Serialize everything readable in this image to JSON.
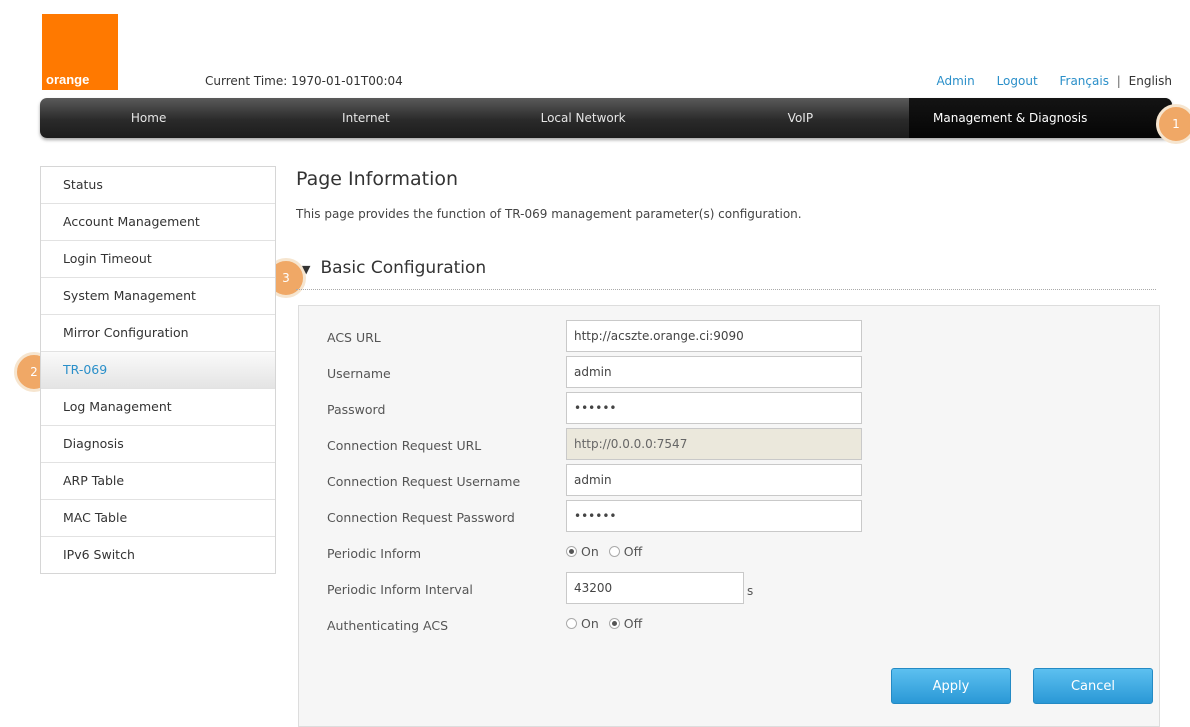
{
  "brand": {
    "logo_text": "orange",
    "color": "#ff7900"
  },
  "header": {
    "current_time_label": "Current Time:",
    "current_time_value": "1970-01-01T00:04",
    "links": {
      "admin": "Admin",
      "logout": "Logout",
      "francais": "Français",
      "separator": "|",
      "english": "English"
    }
  },
  "nav": {
    "items": [
      "Home",
      "Internet",
      "Local Network",
      "VoIP",
      "Management & Diagnosis"
    ],
    "active": "Management & Diagnosis"
  },
  "badges": [
    "1",
    "2",
    "3"
  ],
  "sidebar": {
    "items": [
      "Status",
      "Account Management",
      "Login Timeout",
      "System Management",
      "Mirror Configuration",
      "TR-069",
      "Log Management",
      "Diagnosis",
      "ARP Table",
      "MAC Table",
      "IPv6 Switch"
    ],
    "active": "TR-069"
  },
  "page": {
    "title": "Page Information",
    "description": "This page provides the function of TR-069 management parameter(s) configuration.",
    "section": "Basic Configuration"
  },
  "form": {
    "acs_url": {
      "label": "ACS URL",
      "value": "http://acszte.orange.ci:9090"
    },
    "username": {
      "label": "Username",
      "value": "admin"
    },
    "password": {
      "label": "Password",
      "value": "••••••"
    },
    "conn_req_url": {
      "label": "Connection Request URL",
      "value": "http://0.0.0.0:7547"
    },
    "conn_req_username": {
      "label": "Connection Request Username",
      "value": "admin"
    },
    "conn_req_password": {
      "label": "Connection Request Password",
      "value": "••••••"
    },
    "periodic_inform": {
      "label": "Periodic Inform",
      "on": "On",
      "off": "Off",
      "selected": "On"
    },
    "periodic_inform_interval": {
      "label": "Periodic Inform Interval",
      "value": "43200",
      "unit": "s"
    },
    "authenticating_acs": {
      "label": "Authenticating ACS",
      "on": "On",
      "off": "Off",
      "selected": "Off"
    }
  },
  "buttons": {
    "apply": "Apply",
    "cancel": "Cancel"
  }
}
